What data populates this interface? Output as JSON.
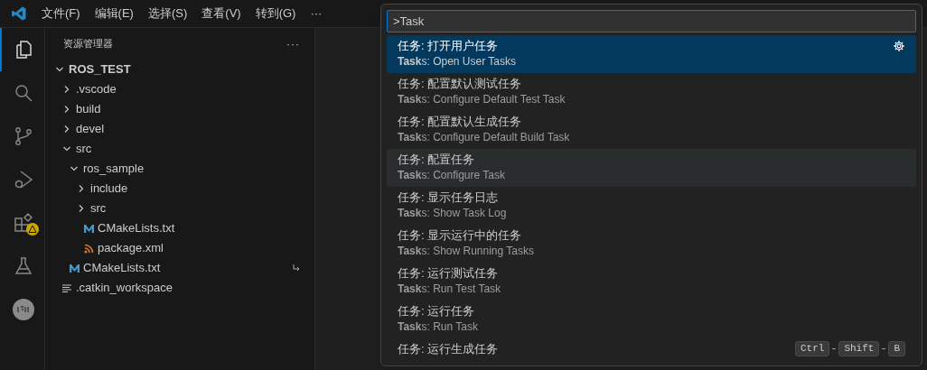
{
  "menu": [
    "文件(F)",
    "编辑(E)",
    "选择(S)",
    "查看(V)",
    "转到(G)",
    "···"
  ],
  "activity_bar": [
    {
      "kind": "explorer",
      "selected": true
    },
    {
      "kind": "search",
      "selected": false
    },
    {
      "kind": "source-control",
      "selected": false
    },
    {
      "kind": "run-debug",
      "selected": false
    },
    {
      "kind": "extensions",
      "selected": false
    },
    {
      "kind": "testing",
      "selected": false
    },
    {
      "kind": "json",
      "selected": false
    }
  ],
  "explorer": {
    "title": "资源管理器",
    "more": "···",
    "root": {
      "label": "ROS_TEST",
      "expanded": true
    },
    "tree": [
      {
        "label": ".vscode",
        "kind": "folder",
        "expanded": false
      },
      {
        "label": "build",
        "kind": "folder",
        "expanded": false
      },
      {
        "label": "devel",
        "kind": "folder",
        "expanded": false
      },
      {
        "label": "src",
        "kind": "folder",
        "expanded": true,
        "children": [
          {
            "label": "ros_sample",
            "kind": "folder",
            "expanded": true,
            "children": [
              {
                "label": "include",
                "kind": "folder",
                "expanded": false
              },
              {
                "label": "src",
                "kind": "folder",
                "expanded": false
              },
              {
                "label": "CMakeLists.txt",
                "kind": "cmake"
              },
              {
                "label": "package.xml",
                "kind": "xml"
              }
            ]
          }
        ]
      },
      {
        "label": "CMakeLists.txt",
        "kind": "cmake",
        "symlink": true
      },
      {
        "label": ".catkin_workspace",
        "kind": "text"
      }
    ]
  },
  "command_palette": {
    "value": ">Task",
    "items": [
      {
        "title": "任务: 打开用户任务",
        "detail": "**Task**s: Open User Tasks",
        "selected": true,
        "hovered": false,
        "gear": true
      },
      {
        "title": "任务: 配置默认测试任务",
        "detail": "**Task**s: Configure Default Test Task",
        "selected": false,
        "hovered": false
      },
      {
        "title": "任务: 配置默认生成任务",
        "detail": "**Task**s: Configure Default Build Task",
        "selected": false,
        "hovered": false
      },
      {
        "title": "任务: 配置任务",
        "detail": "**Task**s: Configure Task",
        "selected": false,
        "hovered": true
      },
      {
        "title": "任务: 显示任务日志",
        "detail": "**Task**s: Show Task Log",
        "selected": false,
        "hovered": false
      },
      {
        "title": "任务: 显示运行中的任务",
        "detail": "**Task**s: Show Running Tasks",
        "selected": false,
        "hovered": false
      },
      {
        "title": "任务: 运行测试任务",
        "detail": "**Task**s: Run Test Task",
        "selected": false,
        "hovered": false
      },
      {
        "title": "任务: 运行任务",
        "detail": "**Task**s: Run Task",
        "selected": false,
        "hovered": false
      },
      {
        "title": "任务: 运行生成任务",
        "selected": false,
        "hovered": false,
        "keys": [
          "Ctrl",
          "Shift",
          "B"
        ]
      }
    ]
  }
}
